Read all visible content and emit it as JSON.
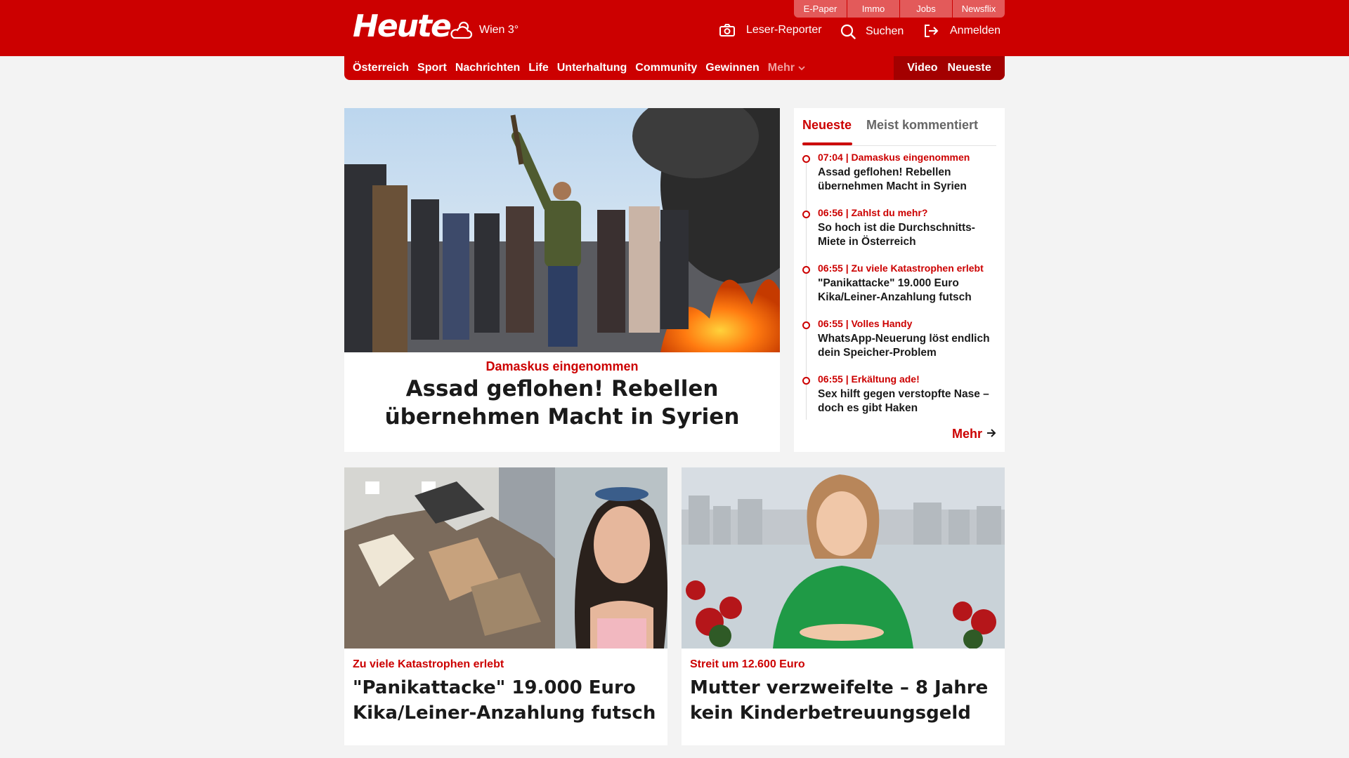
{
  "header": {
    "logo": "Heute",
    "weather_text": "Wien 3°",
    "services": [
      "E-Paper",
      "Immo",
      "Jobs",
      "Newsflix"
    ],
    "reporter_label": "Leser-Reporter",
    "search_label": "Suchen",
    "login_label": "Anmelden"
  },
  "nav": {
    "items": [
      "Österreich",
      "Sport",
      "Nachrichten",
      "Life",
      "Unterhaltung",
      "Community",
      "Gewinnen"
    ],
    "more_label": "Mehr",
    "video_label": "Video",
    "newest_label": "Neueste"
  },
  "hero": {
    "kicker": "Damaskus eingenommen",
    "title": "Assad geflohen! Rebellen übernehmen Macht in Syrien"
  },
  "sidebar": {
    "tab_active": "Neueste",
    "tab_inactive": "Meist kommentiert",
    "items": [
      {
        "meta": "07:04 | Damaskus eingenommen",
        "title": "Assad geflohen! Rebellen übernehmen Macht in Syrien"
      },
      {
        "meta": "06:56 | Zahlst du mehr?",
        "title": "So hoch ist die Durchschnitts-Miete in Österreich"
      },
      {
        "meta": "06:55 | Zu viele Katastrophen erlebt",
        "title": "\"Panikattacke\" 19.000 Euro Kika/Leiner-Anzahlung futsch"
      },
      {
        "meta": "06:55 | Volles Handy",
        "title": "WhatsApp-Neuerung löst endlich dein Speicher-Problem"
      },
      {
        "meta": "06:55 | Erkältung ade!",
        "title": "Sex hilft gegen verstopfte Nase – doch es gibt Haken"
      }
    ],
    "more_label": "Mehr"
  },
  "cards": [
    {
      "kicker": "Zu viele Katastrophen erlebt",
      "title": "\"Panikattacke\" 19.000 Euro Kika/Leiner-Anzahlung futsch"
    },
    {
      "kicker": "Streit um 12.600 Euro",
      "title": "Mutter verzweifelte – 8 Jahre kein Kinderbetreuungsgeld"
    }
  ],
  "colors": {
    "brand": "#cc0000",
    "brand_dark": "#a30000",
    "background": "#f3f3f3"
  }
}
